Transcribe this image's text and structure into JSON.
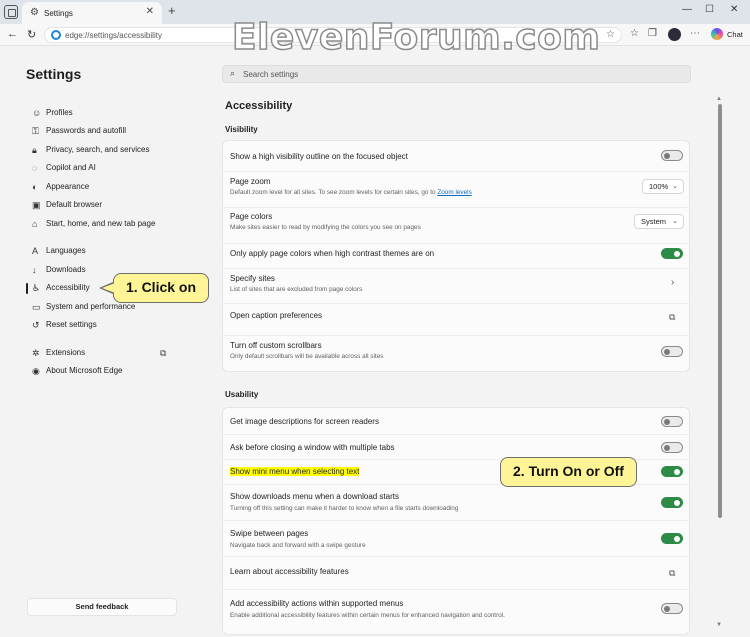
{
  "browser": {
    "tab_title": "Settings",
    "url": "edge://settings/accessibility",
    "chat_label": "Chat",
    "watermark": "ElevenForum.com"
  },
  "sidebar": {
    "title": "Settings",
    "items": [
      {
        "label": "Profiles",
        "icon": "profile-icon"
      },
      {
        "label": "Passwords and autofill",
        "icon": "key-icon"
      },
      {
        "label": "Privacy, search, and services",
        "icon": "lock-icon"
      },
      {
        "label": "Copilot and AI",
        "icon": "copilot-icon"
      },
      {
        "label": "Appearance",
        "icon": "appearance-icon"
      },
      {
        "label": "Default browser",
        "icon": "browser-icon"
      },
      {
        "label": "Start, home, and new tab page",
        "icon": "home-icon"
      },
      {
        "label": "Languages",
        "icon": "languages-icon"
      },
      {
        "label": "Downloads",
        "icon": "download-icon"
      },
      {
        "label": "Accessibility",
        "icon": "accessibility-icon",
        "active": true
      },
      {
        "label": "System and performance",
        "icon": "system-icon"
      },
      {
        "label": "Reset settings",
        "icon": "reset-icon"
      },
      {
        "label": "Extensions",
        "icon": "extensions-icon"
      },
      {
        "label": "About Microsoft Edge",
        "icon": "edge-icon"
      }
    ],
    "feedback": "Send feedback"
  },
  "search": {
    "placeholder": "Search settings"
  },
  "main": {
    "title": "Accessibility",
    "visibility": {
      "heading": "Visibility",
      "outline": {
        "title": "Show a high visibility outline on the focused object",
        "on": false
      },
      "zoom": {
        "title": "Page zoom",
        "desc": "Default zoom level for all sites. To see zoom levels for certain sites, go to ",
        "link": "Zoom levels",
        "value": "100%"
      },
      "colors": {
        "title": "Page colors",
        "desc": "Make sites easier to read by modifying the colors you see on pages",
        "value": "System"
      },
      "contrast": {
        "title": "Only apply page colors when high contrast themes are on",
        "on": true
      },
      "sites": {
        "title": "Specify sites",
        "desc": "List of sites that are excluded from page colors"
      },
      "caption": {
        "title": "Open caption preferences"
      },
      "scrollbars": {
        "title": "Turn off custom scrollbars",
        "desc": "Only default scrollbars will be available across all sites",
        "on": false
      }
    },
    "usability": {
      "heading": "Usability",
      "image_desc": {
        "title": "Get image descriptions for screen readers",
        "on": false
      },
      "ask_close": {
        "title": "Ask before closing a window with multiple tabs",
        "on": false
      },
      "mini_menu": {
        "title": "Show mini menu when selecting text",
        "on": true
      },
      "downloads_menu": {
        "title": "Show downloads menu when a download starts",
        "desc": "Turning off this setting can make it harder to know when a file starts downloading",
        "on": true
      },
      "swipe": {
        "title": "Swipe between pages",
        "desc": "Navigate back and forward with a swipe gesture",
        "on": true
      },
      "learn": {
        "title": "Learn about accessibility features"
      },
      "actions": {
        "title": "Add accessibility actions within supported menus",
        "desc": "Enable additional accessibility features within certain menus for enhanced navigation and control.",
        "on": false
      }
    }
  },
  "callouts": {
    "click": "1. Click on",
    "toggle": "2. Turn On or Off"
  },
  "colors": {
    "toggle_on": "#2e8b45",
    "callout_bg": "#fff596",
    "highlight": "#ffff00",
    "link": "#0f6cbd"
  }
}
